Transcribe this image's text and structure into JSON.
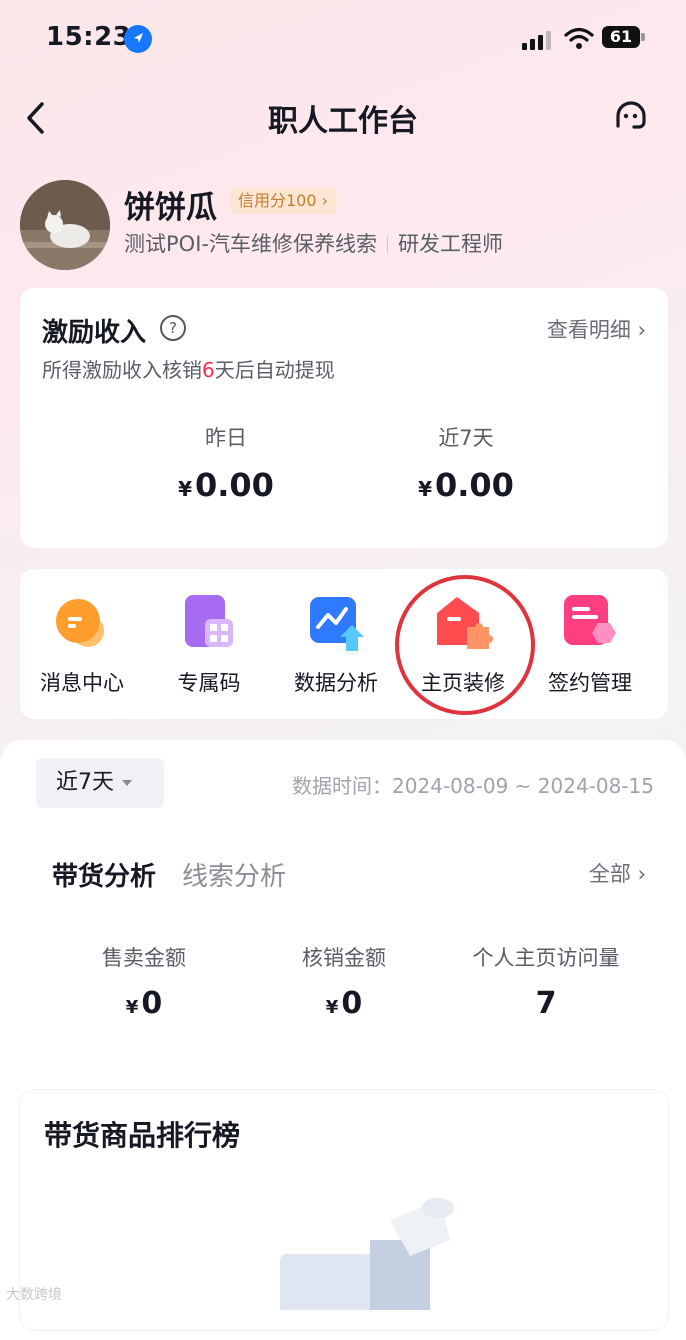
{
  "status_bar": {
    "time": "15:23",
    "battery": "61"
  },
  "nav": {
    "title": "职人工作台"
  },
  "profile": {
    "name": "饼饼瓜",
    "credit_badge": "信用分100 ›",
    "shop": "测试POI-汽车维修保养线索",
    "role": "研发工程师"
  },
  "income": {
    "title": "激励收入",
    "view_detail": "查看明细 ›",
    "sub_prefix": "所得激励收入核销",
    "sub_days": "6",
    "sub_suffix": "天后自动提现",
    "yesterday_label": "昨日",
    "yesterday_value": "0.00",
    "week_label": "近7天",
    "week_value": "0.00",
    "currency": "¥"
  },
  "tools": [
    {
      "label": "消息中心",
      "icon": "message-icon"
    },
    {
      "label": "专属码",
      "icon": "qrcode-icon"
    },
    {
      "label": "数据分析",
      "icon": "chart-icon"
    },
    {
      "label": "主页装修",
      "icon": "home-decor-icon"
    },
    {
      "label": "签约管理",
      "icon": "contract-icon"
    }
  ],
  "data_section": {
    "period": "近7天",
    "data_time": "数据时间：2024-08-09 ~ 2024-08-15",
    "tab_active": "带货分析",
    "tab_inactive": "线索分析",
    "all_link": "全部 ›",
    "kpis": [
      {
        "label": "售卖金额",
        "currency": "¥",
        "value": "0"
      },
      {
        "label": "核销金额",
        "currency": "¥",
        "value": "0"
      },
      {
        "label": "个人主页访问量",
        "currency": "",
        "value": "7"
      }
    ]
  },
  "ranking": {
    "title": "带货商品排行榜"
  },
  "watermark": "大数跨境",
  "colors": {
    "accent_red": "#fe2c55",
    "ring_red": "#e0343d",
    "credit_text": "#c47c2d"
  }
}
